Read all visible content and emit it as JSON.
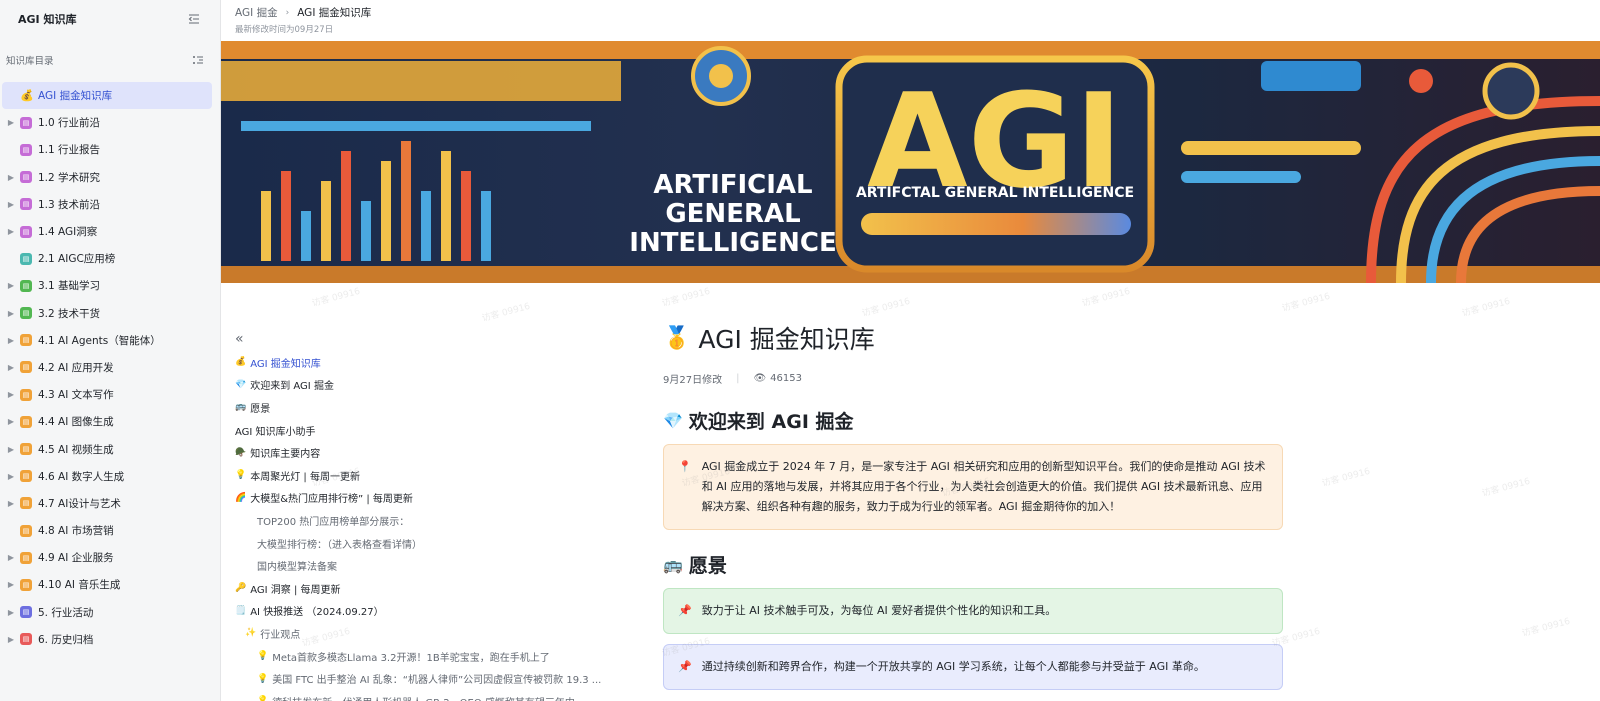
{
  "sidebar": {
    "title": "AGI 知识库",
    "section_label": "知识库目录",
    "items": [
      {
        "label": "AGI 掘金知识库",
        "active": true,
        "caret": false,
        "icon": "medal",
        "color": ""
      },
      {
        "label": "1.0 行业前沿",
        "active": false,
        "caret": true,
        "icon": "doc-icon",
        "color": "#c56cd6"
      },
      {
        "label": "1.1 行业报告",
        "active": false,
        "caret": false,
        "icon": "doc-icon",
        "color": "#c56cd6"
      },
      {
        "label": "1.2 学术研究",
        "active": false,
        "caret": true,
        "icon": "doc-icon",
        "color": "#c56cd6"
      },
      {
        "label": "1.3 技术前沿",
        "active": false,
        "caret": true,
        "icon": "doc-icon",
        "color": "#c56cd6"
      },
      {
        "label": "1.4 AGI洞察",
        "active": false,
        "caret": true,
        "icon": "doc-icon",
        "color": "#c56cd6"
      },
      {
        "label": "2.1 AIGC应用榜",
        "active": false,
        "caret": false,
        "icon": "doc-icon",
        "color": "#4bb8b0"
      },
      {
        "label": "3.1 基础学习",
        "active": false,
        "caret": true,
        "icon": "doc-icon",
        "color": "#52b752"
      },
      {
        "label": "3.2 技术干货",
        "active": false,
        "caret": true,
        "icon": "doc-icon",
        "color": "#52b752"
      },
      {
        "label": "4.1 AI Agents（智能体）",
        "active": false,
        "caret": true,
        "icon": "doc-icon",
        "color": "#f0a238"
      },
      {
        "label": "4.2 AI 应用开发",
        "active": false,
        "caret": true,
        "icon": "doc-icon",
        "color": "#f0a238"
      },
      {
        "label": "4.3 AI 文本写作",
        "active": false,
        "caret": true,
        "icon": "doc-icon",
        "color": "#f0a238"
      },
      {
        "label": "4.4 AI 图像生成",
        "active": false,
        "caret": true,
        "icon": "doc-icon",
        "color": "#f0a238"
      },
      {
        "label": "4.5 AI 视频生成",
        "active": false,
        "caret": true,
        "icon": "doc-icon",
        "color": "#f0a238"
      },
      {
        "label": "4.6 AI 数字人生成",
        "active": false,
        "caret": true,
        "icon": "doc-icon",
        "color": "#f0a238"
      },
      {
        "label": "4.7 AI设计与艺术",
        "active": false,
        "caret": true,
        "icon": "doc-icon",
        "color": "#f0a238"
      },
      {
        "label": "4.8 AI 市场营销",
        "active": false,
        "caret": false,
        "icon": "doc-icon",
        "color": "#f0a238"
      },
      {
        "label": "4.9 AI 企业服务",
        "active": false,
        "caret": true,
        "icon": "doc-icon",
        "color": "#f0a238"
      },
      {
        "label": "4.10 AI 音乐生成",
        "active": false,
        "caret": true,
        "icon": "doc-icon",
        "color": "#f0a238"
      },
      {
        "label": "5. 行业活动",
        "active": false,
        "caret": true,
        "icon": "doc-icon",
        "color": "#6d6fe0"
      },
      {
        "label": "6. 历史归档",
        "active": false,
        "caret": true,
        "icon": "doc-icon",
        "color": "#e85a5a"
      }
    ]
  },
  "topbar": {
    "crumb_root": "AGI 掘金",
    "crumb_current": "AGI 掘金知识库",
    "modified": "最新修改时间为09月27日"
  },
  "banner": {
    "big_text": "AGI",
    "sub_text": "ARTIFCTAL GENERAL INTELLIGENCE",
    "left_line1": "ARTIFICIAL",
    "left_line2": "GENERAL",
    "left_line3": "INTELLIGENCE"
  },
  "toc": {
    "items": [
      {
        "label": "AGI 掘金知识库",
        "emoji": "💰",
        "level": "l1",
        "active": true
      },
      {
        "label": "欢迎来到 AGI 掘金",
        "emoji": "💎",
        "level": "l1",
        "active": false
      },
      {
        "label": "愿景",
        "emoji": "🚌",
        "level": "l1",
        "active": false
      },
      {
        "label": "AGI 知识库小助手",
        "emoji": "",
        "level": "l1",
        "active": false
      },
      {
        "label": "知识库主要内容",
        "emoji": "🪖",
        "level": "l1",
        "active": false
      },
      {
        "label": "本周聚光灯 | 每周一更新",
        "emoji": "💡",
        "level": "l1",
        "active": false
      },
      {
        "label": "大模型&热门应用排行榜” | 每周更新",
        "emoji": "🌈",
        "level": "l1",
        "active": false
      },
      {
        "label": "TOP200 热门应用榜单部分展示：",
        "emoji": "",
        "level": "l2",
        "active": false
      },
      {
        "label": "大模型排行榜：（进入表格查看详情）",
        "emoji": "",
        "level": "l2",
        "active": false
      },
      {
        "label": "国内模型算法备案",
        "emoji": "",
        "level": "l2",
        "active": false
      },
      {
        "label": "AGI 洞察 | 每周更新",
        "emoji": "🔑",
        "level": "l1",
        "active": false
      },
      {
        "label": "AI 快报推送 （2024.09.27）",
        "emoji": "🗒️",
        "level": "l1",
        "active": false
      },
      {
        "label": "行业观点",
        "emoji": "✨",
        "level": "l2b",
        "active": false
      },
      {
        "label": "Meta首款多模态Llama 3.2开源！1B羊驼宝宝，跑在手机上了",
        "emoji": "💡",
        "level": "l3",
        "active": false
      },
      {
        "label": "美国 FTC 出手整治 AI 乱象：“机器人律师”公司因虚假宣传被罚款 19.3 ...",
        "emoji": "💡",
        "level": "l3",
        "active": false
      },
      {
        "label": "德科技发布新一代通用人形机器人 GR-2，OEO 感慨称其有望三年内...",
        "emoji": "💡",
        "level": "l3",
        "active": false
      }
    ]
  },
  "doc": {
    "title": "AGI 掘金知识库",
    "title_emoji": "🥇",
    "modified": "9月27日修改",
    "views": "46153",
    "welcome_heading": "欢迎来到 AGI 掘金",
    "welcome_emoji": "💎",
    "welcome_icon": "📍",
    "welcome_text": "AGI 掘金成立于 2024 年 7 月，是一家专注于 AGI 相关研究和应用的创新型知识平台。我们的使命是推动 AGI 技术和 AI 应用的落地与发展，并将其应用于各个行业，为人类社会创造更大的价值。我们提供 AGI 技术最新讯息、应用解决方案、组织各种有趣的服务，致力于成为行业的领军者。AGI 掘金期待你的加入！",
    "vision_heading": "愿景",
    "vision_emoji": "🚌",
    "vision_icon": "📌",
    "vision_1": "致力于让 AI 技术触手可及，为每位 AI 爱好者提供个性化的知识和工具。",
    "vision_2": "通过持续创新和跨界合作，构建一个开放共享的 AGI 学习系统，让每个人都能参与并受益于 AGI 革命。"
  },
  "watermark": "访客 09916"
}
